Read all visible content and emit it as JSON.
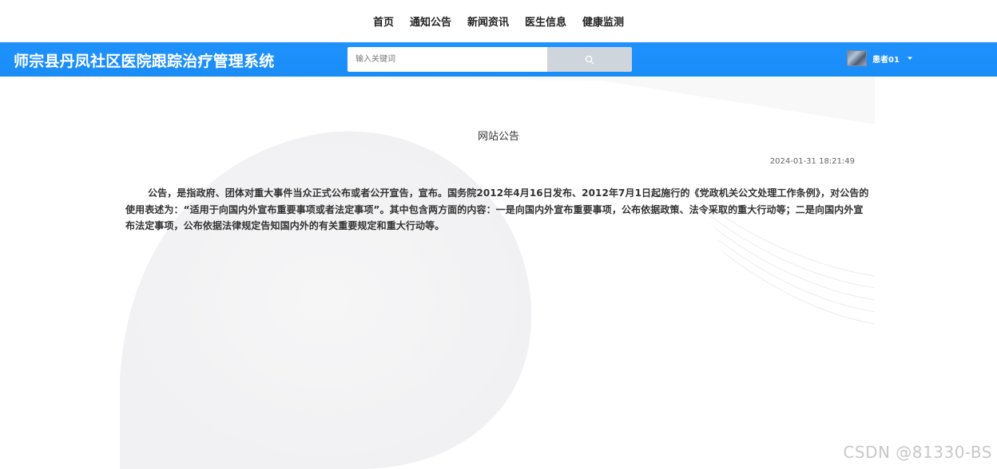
{
  "nav": {
    "items": [
      "首页",
      "通知公告",
      "新闻资讯",
      "医生信息",
      "健康监测"
    ]
  },
  "header": {
    "site_title": "师宗县丹凤社区医院跟踪治疗管理系统",
    "search_placeholder": "输入关键词",
    "search_icon": "search-icon",
    "username": "患者01",
    "dropdown_icon": "caret-down-icon"
  },
  "notice": {
    "title": "网站公告",
    "time": "2024-01-31 18:21:49",
    "content": "公告，是指政府、团体对重大事件当众正式公布或者公开宣告，宣布。国务院2012年4月16日发布、2012年7月1日起施行的《党政机关公文处理工作条例》，对公告的使用表述为：“适用于向国内外宣布重要事项或者法定事项”。其中包含两方面的内容：一是向国内外宣布重要事项，公布依据政策、法令采取的重大行动等；二是向国内外宣布法定事项，公布依据法律规定告知国内外的有关重要规定和重大行动等。"
  },
  "watermark": "CSDN @81330-BS",
  "colors": {
    "header_bg": "#1e90ff",
    "search_button": "#cfd5dd"
  }
}
